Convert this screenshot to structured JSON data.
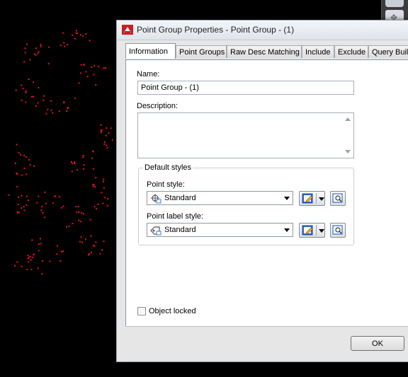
{
  "dialog": {
    "title": "Point Group Properties - Point Group - (1)"
  },
  "tabs": [
    {
      "label": "Information",
      "active": true
    },
    {
      "label": "Point Groups",
      "active": false
    },
    {
      "label": "Raw Desc Matching",
      "active": false
    },
    {
      "label": "Include",
      "active": false
    },
    {
      "label": "Exclude",
      "active": false
    },
    {
      "label": "Query Buil",
      "active": false
    }
  ],
  "information": {
    "name_label": "Name:",
    "name_value": "Point Group - (1)",
    "description_label": "Description:",
    "description_value": "",
    "default_styles_label": "Default styles",
    "point_style_label": "Point style:",
    "point_style_value": "Standard",
    "point_label_style_label": "Point label style:",
    "point_label_style_value": "Standard",
    "object_locked_label": "Object locked",
    "object_locked_checked": false
  },
  "footer": {
    "ok_label": "OK"
  },
  "colors": {
    "background": "#000000",
    "point_marker": "#e8141c",
    "dialog_bg": "#e6e6e6",
    "accent_blue": "#2e6bd6"
  }
}
